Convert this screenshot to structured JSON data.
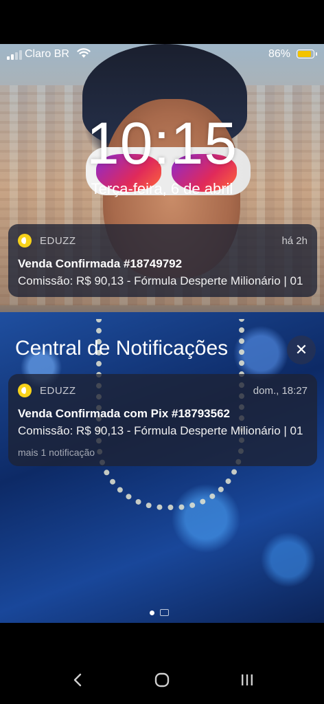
{
  "status_bar": {
    "carrier": "Claro BR",
    "battery_percent": "86%",
    "battery_level": 0.86,
    "battery_color": "#f3c300",
    "icons": [
      "signal-icon",
      "wifi-icon",
      "battery-icon"
    ]
  },
  "lock_screen": {
    "time": "10:15",
    "date": "Terça-feira, 6 de abril"
  },
  "notifications": [
    {
      "app": "EDUZZ",
      "time": "há 2h",
      "title": "Venda Confirmada #18749792",
      "body": "Comissão: R$ 90,13 - Fórmula Desperte Milionário | 01",
      "icon": "eduzz-app-icon"
    }
  ],
  "notification_center": {
    "title": "Central de Notificações",
    "close_icon": "close-icon",
    "items": [
      {
        "app": "EDUZZ",
        "time": "dom., 18:27",
        "title": "Venda Confirmada com Pix #18793562",
        "body": "Comissão: R$ 90,13 - Fórmula Desperte Milionário | 01",
        "more": "mais 1 notificação",
        "icon": "eduzz-app-icon"
      }
    ]
  },
  "navigation": {
    "buttons": [
      "back-icon",
      "home-icon",
      "recents-icon"
    ]
  }
}
